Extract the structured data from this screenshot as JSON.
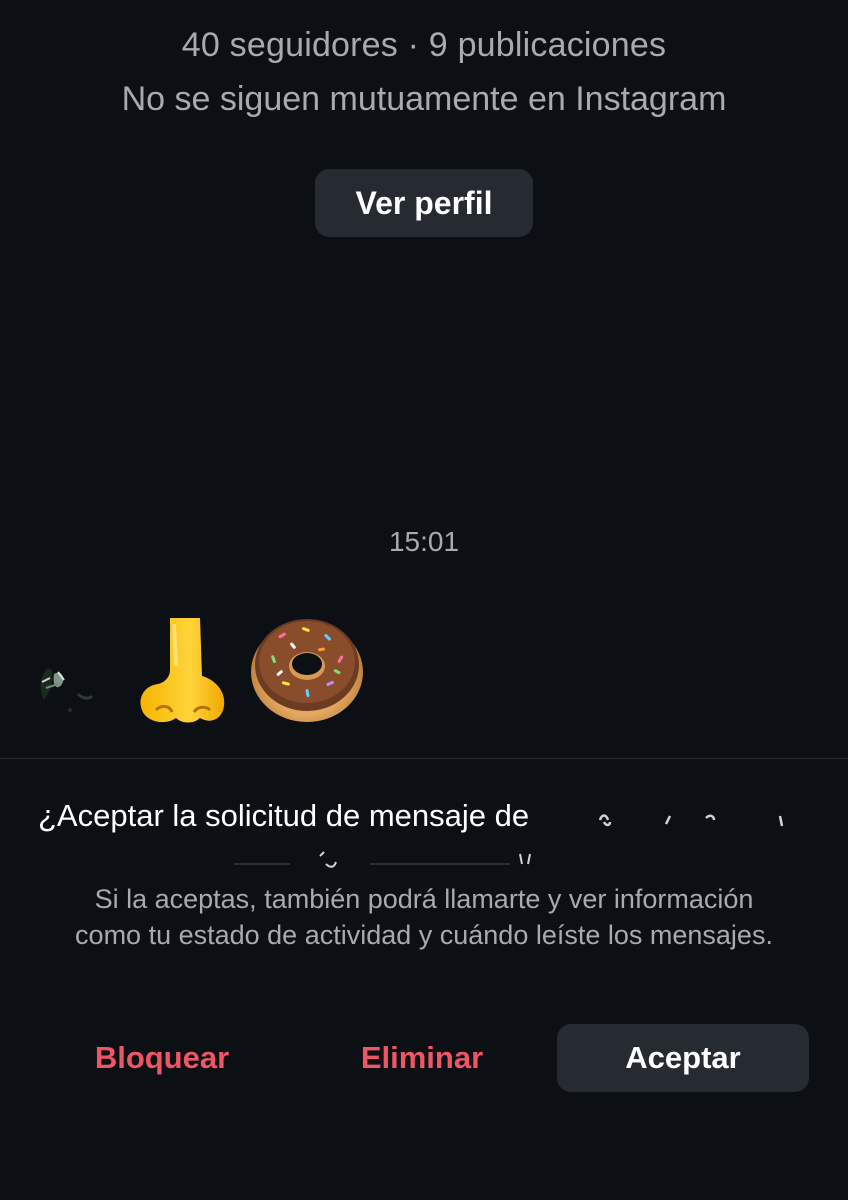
{
  "profile": {
    "stats": "40 seguidores · 9 publicaciones",
    "mutual_note": "No se siguen mutuamente en Instagram",
    "view_profile_label": "Ver perfil"
  },
  "thread": {
    "timestamp": "15:01",
    "message_emojis": [
      "nose-emoji",
      "doughnut-emoji"
    ]
  },
  "request": {
    "title": "¿Aceptar la solicitud de mensaje de",
    "description": "Si la aceptas, también podrá llamarte y ver información como tu estado de actividad y cuándo leíste los mensajes."
  },
  "actions": {
    "block_label": "Bloquear",
    "delete_label": "Eliminar",
    "accept_label": "Aceptar"
  },
  "colors": {
    "background": "#0c0f14",
    "button_bg": "#262a31",
    "secondary_text": "#a7aab0",
    "destructive": "#ee5566"
  }
}
